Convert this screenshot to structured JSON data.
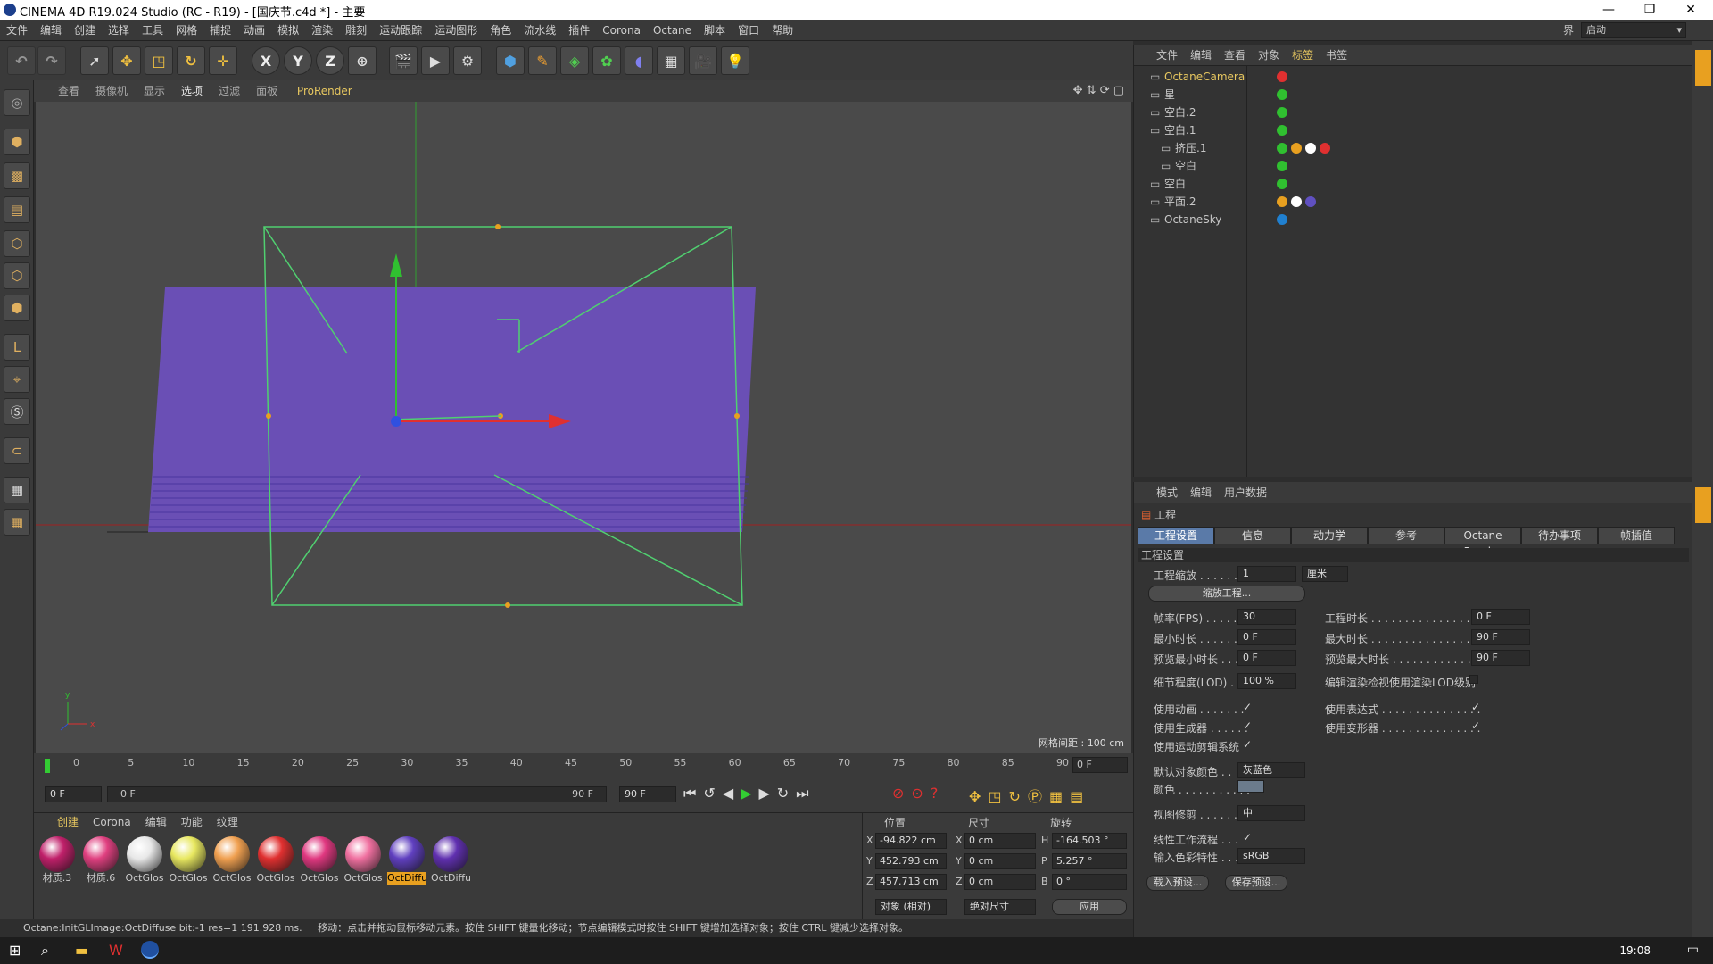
{
  "window": {
    "title": "CINEMA 4D R19.024 Studio (RC - R19) - [国庆节.c4d *] - 主要",
    "controls": [
      "—",
      "❐",
      "✕"
    ]
  },
  "menu": {
    "items": [
      "文件",
      "编辑",
      "创建",
      "选择",
      "工具",
      "网格",
      "捕捉",
      "动画",
      "模拟",
      "渲染",
      "雕刻",
      "运动跟踪",
      "运动图形",
      "角色",
      "流水线",
      "插件",
      "Corona",
      "Octane",
      "脚本",
      "窗口",
      "帮助"
    ],
    "layout_label": "界面:",
    "layout_value": "启动"
  },
  "toolbar": {
    "axis_x": "X",
    "axis_y": "Y",
    "axis_z": "Z"
  },
  "viewport": {
    "menu": [
      "查看",
      "摄像机",
      "显示",
      "选项",
      "过滤",
      "面板"
    ],
    "prorender": "ProRender",
    "grid_spacing": "网格间距 : 100 cm",
    "colors": {
      "background": "#4a4a4a",
      "plane": "#6a4fb5",
      "camera_frame": "#50d070",
      "x_axis": "#e03030",
      "y_axis": "#30c030",
      "z_axis": "#3050e0"
    }
  },
  "timeline": {
    "ticks": [
      "0",
      "5",
      "10",
      "15",
      "20",
      "25",
      "30",
      "35",
      "40",
      "45",
      "50",
      "55",
      "60",
      "65",
      "70",
      "75",
      "80",
      "85",
      "90"
    ],
    "current_frame": "0 F"
  },
  "transport": {
    "start": "0 F",
    "range_start": "0 F",
    "range_end": "90 F",
    "end": "90 F"
  },
  "materials": {
    "menu": [
      "创建",
      "Corona",
      "编辑",
      "功能",
      "纹理"
    ],
    "items": [
      {
        "label": "材质.3",
        "color": "#c0206a"
      },
      {
        "label": "材质.6",
        "color": "#e04080"
      },
      {
        "label": "OctGlos",
        "color": "#e8e8e8"
      },
      {
        "label": "OctGlos",
        "color": "#e8e860"
      },
      {
        "label": "OctGlos",
        "color": "#f0a050"
      },
      {
        "label": "OctGlos",
        "color": "#e03030"
      },
      {
        "label": "OctGlos",
        "color": "#e03880"
      },
      {
        "label": "OctGlos",
        "color": "#f070a0"
      },
      {
        "label": "OctDiffu",
        "color": "#6040c0"
      },
      {
        "label": "OctDiffu",
        "color": "#6030b0"
      }
    ]
  },
  "coordinates": {
    "headers": [
      "位置",
      "尺寸",
      "旋转"
    ],
    "rows": [
      {
        "axis": "X",
        "pos": "-94.822 cm",
        "size_axis": "X",
        "size": "0 cm",
        "rot_axis": "H",
        "rot": "-164.503 °"
      },
      {
        "axis": "Y",
        "pos": "452.793 cm",
        "size_axis": "Y",
        "size": "0 cm",
        "rot_axis": "P",
        "rot": "5.257 °"
      },
      {
        "axis": "Z",
        "pos": "457.713 cm",
        "size_axis": "Z",
        "size": "0 cm",
        "rot_axis": "B",
        "rot": "0 °"
      }
    ],
    "mode": "对象 (相对)",
    "size_mode": "绝对尺寸",
    "apply": "应用"
  },
  "status": {
    "left": "Octane:InitGLImage:OctDiffuse  bit:-1 res=1  191.928 ms.",
    "right": "移动：点击并拖动鼠标移动元素。按住 SHIFT 键量化移动；节点编辑模式时按住 SHIFT 键增加选择对象；按住 CTRL 键减少选择对象。"
  },
  "object_manager": {
    "menu": [
      "文件",
      "编辑",
      "查看",
      "对象",
      "标签",
      "书签"
    ],
    "objects": [
      {
        "name": "OctaneCamera",
        "highlight": true
      },
      {
        "name": "星"
      },
      {
        "name": "空白.2"
      },
      {
        "name": "空白.1"
      },
      {
        "name": "挤压.1"
      },
      {
        "name": "空白"
      },
      {
        "name": "空白"
      },
      {
        "name": "平面.2"
      },
      {
        "name": "OctaneSky"
      }
    ]
  },
  "attribute_manager": {
    "menu": [
      "模式",
      "编辑",
      "用户数据"
    ],
    "object_label": "工程",
    "tabs": [
      "工程设置",
      "信息",
      "动力学",
      "参考",
      "Octane Render",
      "待办事项",
      "帧插值"
    ],
    "section": "工程设置",
    "scale_label": "工程缩放 . . . . . .",
    "scale_value": "1",
    "scale_unit": "厘米",
    "scale_button": "缩放工程...",
    "fps_label": "帧率(FPS) . . . . . .",
    "fps_value": "30",
    "project_time_label": "工程时长 . . . . . . . . . . . . . . . .",
    "project_time_value": "0 F",
    "min_time_label": "最小时长 . . . . . . .",
    "min_time_value": "0 F",
    "max_time_label": "最大时长 . . . . . . . . . . . . . . . .",
    "max_time_value": "90 F",
    "preview_min_label": "预览最小时长 . . .",
    "preview_min_value": "0 F",
    "preview_max_label": "预览最大时长 . . . . . . . . . . . . .",
    "preview_max_value": "90 F",
    "lod_label": "细节程度(LOD) .",
    "lod_value": "100 %",
    "render_lod_label": "编辑渲染检视使用渲染LOD级别",
    "use_anim_label": "使用动画 . . . . . . .",
    "use_expr_label": "使用表达式 . . . . . . . . . . . . . . .",
    "use_gen_label": "使用生成器 . . . . . .",
    "use_deform_label": "使用变形器 . . . . . . . . . . . . . . .",
    "use_motion_label": "使用运动剪辑系统",
    "default_color_label": "默认对象颜色 . .",
    "default_color_value": "灰蓝色",
    "color_label": "颜色 . . . . . . . . . . .",
    "clipping_label": "视图修剪 . . . . . . .",
    "clipping_value": "中",
    "linear_label": "线性工作流程 . . .",
    "input_color_label": "输入色彩特性 . . .",
    "input_color_value": "sRGB",
    "load_preset": "载入预设...",
    "save_preset": "保存预设...",
    "check": "✓"
  },
  "taskbar": {
    "time": "19:08"
  }
}
